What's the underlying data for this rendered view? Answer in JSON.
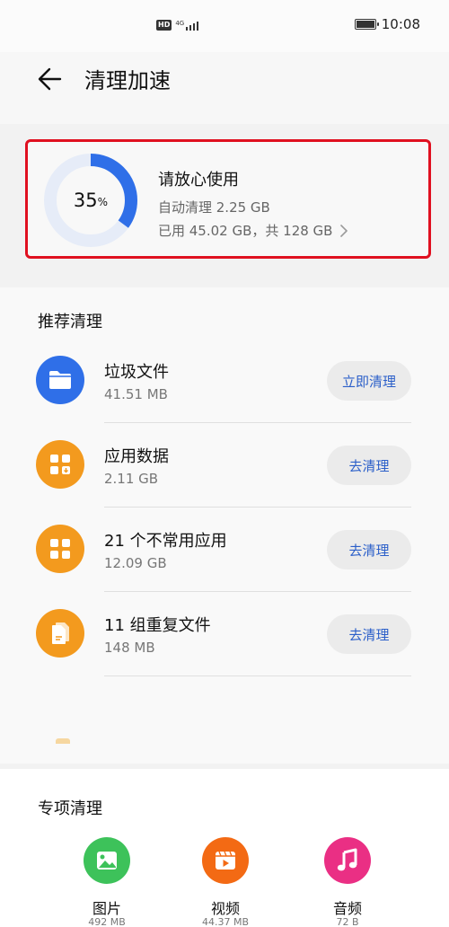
{
  "status_bar": {
    "network_badge": "HD",
    "network_type": "4G",
    "time": "10:08"
  },
  "header": {
    "title": "清理加速",
    "back_icon": "arrow-left-icon"
  },
  "storage_card": {
    "percent_value": "35",
    "percent_unit": "%",
    "usage_fraction": 0.35,
    "ring_color": "#2f6fe8",
    "ring_track_color": "#e6ecf8",
    "title": "请放心使用",
    "auto_clean": "自动清理 2.25 GB",
    "usage": "已用 45.02 GB，共 128 GB"
  },
  "recommended": {
    "title": "推荐清理",
    "items": [
      {
        "icon": "folder-icon",
        "color": "#2f6fe8",
        "name": "垃圾文件",
        "size": "41.51 MB",
        "button": "立即清理"
      },
      {
        "icon": "app-data-icon",
        "color": "#f39a1e",
        "name": "应用数据",
        "size": "2.11 GB",
        "button": "去清理"
      },
      {
        "icon": "apps-grid-icon",
        "color": "#f39a1e",
        "name": "21 个不常用应用",
        "size": "12.09 GB",
        "button": "去清理"
      },
      {
        "icon": "duplicate-file-icon",
        "color": "#f39a1e",
        "name": "11 组重复文件",
        "size": "148 MB",
        "button": "去清理"
      }
    ]
  },
  "special": {
    "title": "专项清理",
    "items": [
      {
        "icon": "image-icon",
        "color": "#3dc25a",
        "name": "图片",
        "size": "492 MB"
      },
      {
        "icon": "video-icon",
        "color": "#f36a14",
        "name": "视频",
        "size": "44.37 MB"
      },
      {
        "icon": "music-note-icon",
        "color": "#ea2f84",
        "name": "音频",
        "size": "72 B"
      }
    ]
  }
}
